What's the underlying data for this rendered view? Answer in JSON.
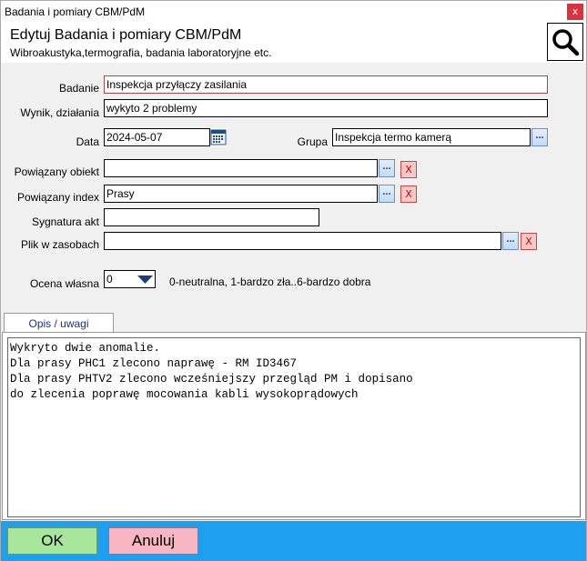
{
  "window": {
    "title": "Badania i pomiary CBM/PdM",
    "close_label": "x"
  },
  "header": {
    "title": "Edytuj Badania i pomiary CBM/PdM",
    "subtitle": "Wibroakustyka,termografia, badania laboratoryjne etc."
  },
  "form": {
    "badanie_label": "Badanie",
    "badanie_value": "Inspekcja przyłączy zasilania",
    "wynik_label": "Wynik, działania",
    "wynik_value": "wykyto 2 problemy",
    "data_label": "Data",
    "data_value": "2024-05-07",
    "grupa_label": "Grupa",
    "grupa_value": "Inspekcja termo kamerą",
    "obiekt_label": "Powiązany obiekt",
    "obiekt_value": "",
    "index_label": "Powiązany index",
    "index_value": "Prasy",
    "sygnatura_label": "Sygnatura akt",
    "sygnatura_value": "",
    "plik_label": "Plik w zasobach",
    "plik_value": "",
    "ocena_label": "Ocena własna",
    "ocena_value": "0",
    "ocena_hint": "0-neutralna, 1-bardzo zła..6-bardzo dobra",
    "dots_label": "...",
    "clear_label": "X"
  },
  "tabs": [
    {
      "label": "Opis / uwagi"
    }
  ],
  "notes": "Wykryto dwie anomalie.\nDla prasy PHC1 zlecono naprawę - RM ID3467\nDla prasy PHTV2 zlecono wcześniejszy przegląd PM i dopisano\ndo zlecenia poprawę mocowania kabli wysokoprądowych",
  "footer": {
    "ok_label": "OK",
    "cancel_label": "Anuluj"
  },
  "icons": {
    "search": "search-icon",
    "calendar": "calendar-icon",
    "dropdown": "chevron-down-icon"
  }
}
